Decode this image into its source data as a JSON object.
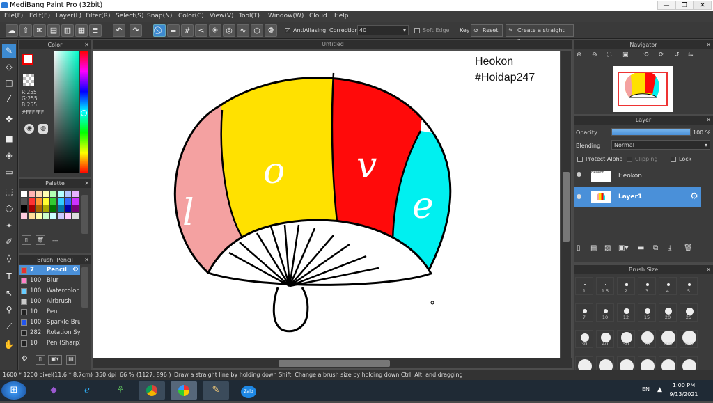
{
  "window": {
    "title": "MediBang Paint Pro (32bit)"
  },
  "menu": [
    "File(F)",
    "Edit(E)",
    "Layer(L)",
    "Filter(R)",
    "Select(S)",
    "Snap(N)",
    "Color(C)",
    "View(V)",
    "Tool(T)",
    "Window(W)",
    "Cloud",
    "Help"
  ],
  "toolbar": {
    "antialiasing": "AntiAliasing",
    "correction_label": "Correction",
    "correction_value": "40",
    "soft_edge": "Soft Edge",
    "key": "Key",
    "reset": "Reset",
    "straight_line": "Create a straight line"
  },
  "color_panel": {
    "title": "Color",
    "r": "R:255",
    "g": "G:255",
    "b": "B:255",
    "hex": "#FFFFFF"
  },
  "palette_panel": {
    "title": "Palette",
    "footer": "---"
  },
  "brush_panel": {
    "title": "Brush: Pencil",
    "items": [
      {
        "size": "7",
        "name": "Pencil",
        "color": "#e83030",
        "selected": true
      },
      {
        "size": "100",
        "name": "Blur",
        "color": "#ff7fc8"
      },
      {
        "size": "100",
        "name": "Watercolor",
        "color": "#66ccff"
      },
      {
        "size": "100",
        "name": "Airbrush",
        "color": "#cccccc"
      },
      {
        "size": "10",
        "name": "Pen",
        "color": "#222222"
      },
      {
        "size": "100",
        "name": "Sparkle Brush",
        "color": "#2255ee"
      },
      {
        "size": "282",
        "name": "Rotation Sym",
        "color": "#222222"
      },
      {
        "size": "10",
        "name": "Pen (Sharp)",
        "color": "#222222"
      }
    ]
  },
  "canvas": {
    "tab": "Untitled",
    "text_line1": "Heokon",
    "text_line2": "#Hoidap247",
    "letters": [
      "l",
      "o",
      "v",
      "e"
    ]
  },
  "navigator": {
    "title": "Navigator"
  },
  "layer_panel": {
    "title": "Layer",
    "opacity_label": "Opacity",
    "opacity_value": "100 %",
    "opacity_fraction": 1.0,
    "blending_label": "Blending",
    "blending_value": "Normal",
    "protect_alpha": "Protect Alpha",
    "clipping": "Clipping",
    "lock": "Lock",
    "layers": [
      {
        "name": "Heokon",
        "selected": false
      },
      {
        "name": "Layer1",
        "selected": true
      }
    ]
  },
  "brush_size_panel": {
    "title": "Brush Size",
    "sizes": [
      "1",
      "1.5",
      "2",
      "3",
      "4",
      "5",
      "7",
      "10",
      "12",
      "15",
      "20",
      "25",
      "30",
      "40",
      "50",
      "70",
      "100",
      "150"
    ]
  },
  "status": {
    "size": "1600 * 1200 pixel",
    "cm": "(11.6 * 8.7cm)",
    "dpi": "350 dpi",
    "zoom": "66 %",
    "coords": "(1127, 896 )",
    "hint": "Draw a straight line by holding down Shift, Change a brush size by holding down Ctrl, Alt, and dragging"
  },
  "taskbar": {
    "lang": "EN",
    "time": "1:00 PM",
    "date": "9/13/2021",
    "zalo": "Zalo"
  },
  "colors": {
    "accent": "#3d8ad0",
    "pink": "#f4a1a1",
    "yellow": "#ffe100",
    "red": "#ff0a0a",
    "cyan": "#00f0f0"
  }
}
